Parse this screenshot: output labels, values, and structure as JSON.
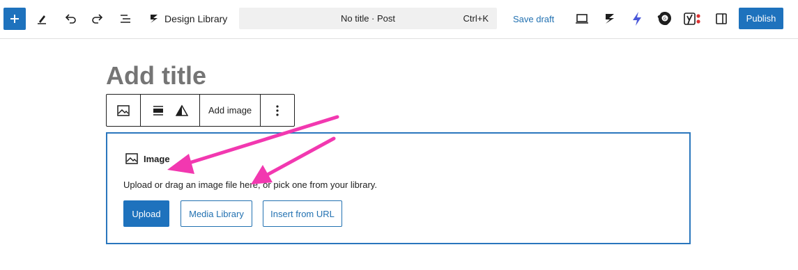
{
  "topbar": {
    "brand_label": "Design Library",
    "command": {
      "title": "No title · Post",
      "shortcut": "Ctrl+K"
    },
    "save_draft": "Save draft",
    "publish": "Publish",
    "icons": [
      "plus-icon",
      "pencil-icon",
      "undo-icon",
      "redo-icon",
      "list-view-icon",
      "design-library-icon",
      "preview-icon",
      "stackable-icon",
      "bolt-icon",
      "grammarly-icon",
      "yoast-icon",
      "settings-sidebar-icon"
    ]
  },
  "editor": {
    "title_placeholder": "Add title",
    "block_toolbar": {
      "add_image": "Add image"
    },
    "image_block": {
      "label": "Image",
      "instructions": "Upload or drag an image file here, or pick one from your library.",
      "upload": "Upload",
      "media_library": "Media Library",
      "insert_from_url": "Insert from URL"
    }
  },
  "colors": {
    "accent": "#1e72bd",
    "annotation": "#f238b0",
    "border": "#2a76bd"
  }
}
